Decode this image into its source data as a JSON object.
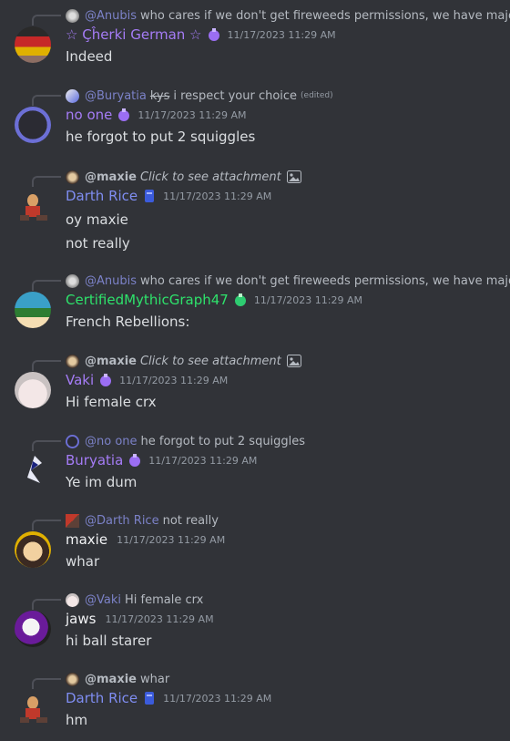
{
  "messages": [
    {
      "reply": {
        "mention": "@Anubis",
        "text": "who cares if we don't get fireweeds permissions, we have majority"
      },
      "author": "☆ Çĥerki German ☆",
      "author_color": "#a57cf6",
      "timestamp": "11/17/2023 11:29 AM",
      "lines": [
        "Indeed"
      ]
    },
    {
      "reply": {
        "mention": "@Buryatia",
        "strike": "kys",
        "text": "i respect your choice",
        "edited": "(edited)"
      },
      "author": "no one",
      "author_color": "#a57cf6",
      "timestamp": "11/17/2023 11:29 AM",
      "lines": [
        "he forgot to put 2 squiggles"
      ]
    },
    {
      "reply": {
        "author": "@maxie",
        "italic": "Click to see attachment",
        "icon": "image-icon"
      },
      "author": "Darth Rice",
      "author_color": "#7f8df1",
      "timestamp": "11/17/2023 11:29 AM",
      "lines": [
        "oy maxie",
        "not really"
      ]
    },
    {
      "reply": {
        "mention": "@Anubis",
        "text": "who cares if we don't get fireweeds permissions, we have majority"
      },
      "author": "CertifiedMythicGraph47",
      "author_color": "#2ee26b",
      "timestamp": "11/17/2023 11:29 AM",
      "lines": [
        "French Rebellions:"
      ]
    },
    {
      "reply": {
        "author": "@maxie",
        "italic": "Click to see attachment",
        "icon": "image-icon"
      },
      "author": "Vaki",
      "author_color": "#a57cf6",
      "timestamp": "11/17/2023 11:29 AM",
      "lines": [
        "Hi female crx"
      ]
    },
    {
      "reply": {
        "mention": "@no one",
        "text": "he forgot to put 2 squiggles"
      },
      "author": "Buryatia",
      "author_color": "#a57cf6",
      "timestamp": "11/17/2023 11:29 AM",
      "lines": [
        "Ye im dum"
      ]
    },
    {
      "reply": {
        "mention": "@Darth Rice",
        "text": "not really"
      },
      "author": "maxie",
      "author_color": "#f2f3f5",
      "timestamp": "11/17/2023 11:29 AM",
      "lines": [
        "whar"
      ]
    },
    {
      "reply": {
        "mention": "@Vaki",
        "text": "Hi female crx"
      },
      "author": "jaws",
      "author_color": "#f2f3f5",
      "timestamp": "11/17/2023 11:29 AM",
      "lines": [
        "hi ball starer"
      ]
    },
    {
      "reply": {
        "author": "@maxie",
        "text": "whar"
      },
      "author": "Darth Rice",
      "author_color": "#7f8df1",
      "timestamp": "11/17/2023 11:29 AM",
      "lines": [
        "hm"
      ]
    }
  ]
}
